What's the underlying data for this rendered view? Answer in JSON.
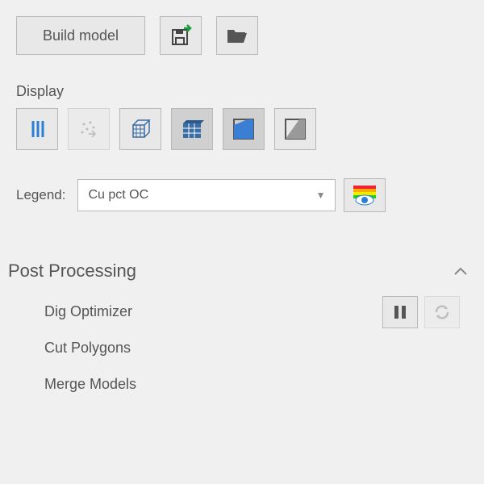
{
  "toolbar": {
    "build_label": "Build model"
  },
  "display": {
    "label": "Display"
  },
  "legend": {
    "label": "Legend:",
    "selected": "Cu pct OC"
  },
  "post_processing": {
    "title": "Post Processing",
    "items": [
      {
        "label": "Dig Optimizer"
      },
      {
        "label": "Cut Polygons"
      },
      {
        "label": "Merge Models"
      }
    ]
  }
}
